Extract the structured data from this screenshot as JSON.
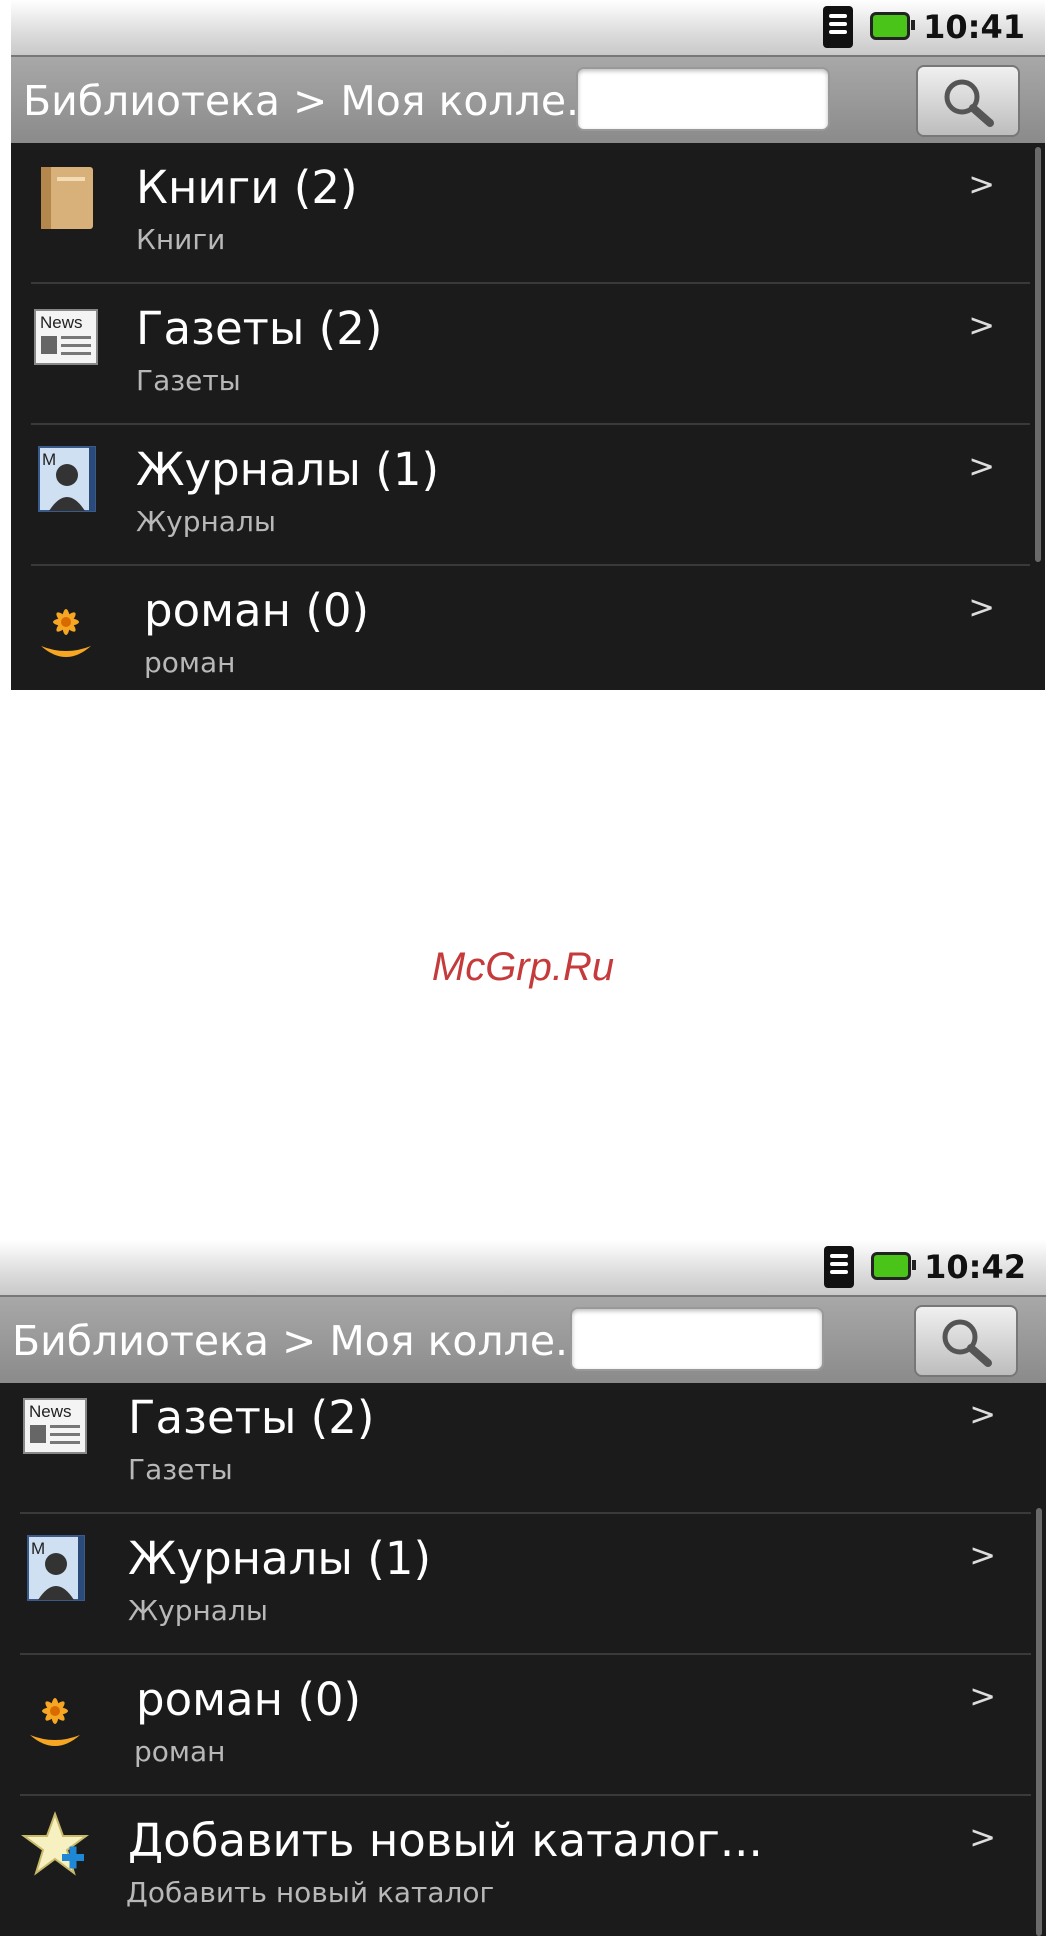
{
  "screens": [
    {
      "status": {
        "time": "10:41"
      },
      "breadcrumb": "Библиотека > Моя колле...",
      "rows": [
        {
          "title": "Книги (2)",
          "subtitle": "Книги",
          "arrow": ">",
          "icon": "book-icon"
        },
        {
          "title": "Газеты (2)",
          "subtitle": "Газеты",
          "arrow": ">",
          "icon": "newspaper-icon"
        },
        {
          "title": "Журналы (1)",
          "subtitle": "Журналы",
          "arrow": ">",
          "icon": "magazine-icon"
        },
        {
          "title": "роман (0)",
          "subtitle": "роман",
          "arrow": ">",
          "icon": "flower-icon"
        }
      ]
    },
    {
      "status": {
        "time": "10:42"
      },
      "breadcrumb": "Библиотека > Моя колле...",
      "rows": [
        {
          "title": "Газеты (2)",
          "subtitle": "Газеты",
          "arrow": ">",
          "icon": "newspaper-icon"
        },
        {
          "title": "Журналы (1)",
          "subtitle": "Журналы",
          "arrow": ">",
          "icon": "magazine-icon"
        },
        {
          "title": "роман (0)",
          "subtitle": "роман",
          "arrow": ">",
          "icon": "flower-icon"
        },
        {
          "title": "Добавить новый каталог...",
          "subtitle": "Добавить новый каталог",
          "arrow": ">",
          "icon": "add-star-icon"
        }
      ]
    }
  ],
  "watermark": "McGrp.Ru",
  "news_icon_label": "News",
  "magazine_icon_label": "M"
}
